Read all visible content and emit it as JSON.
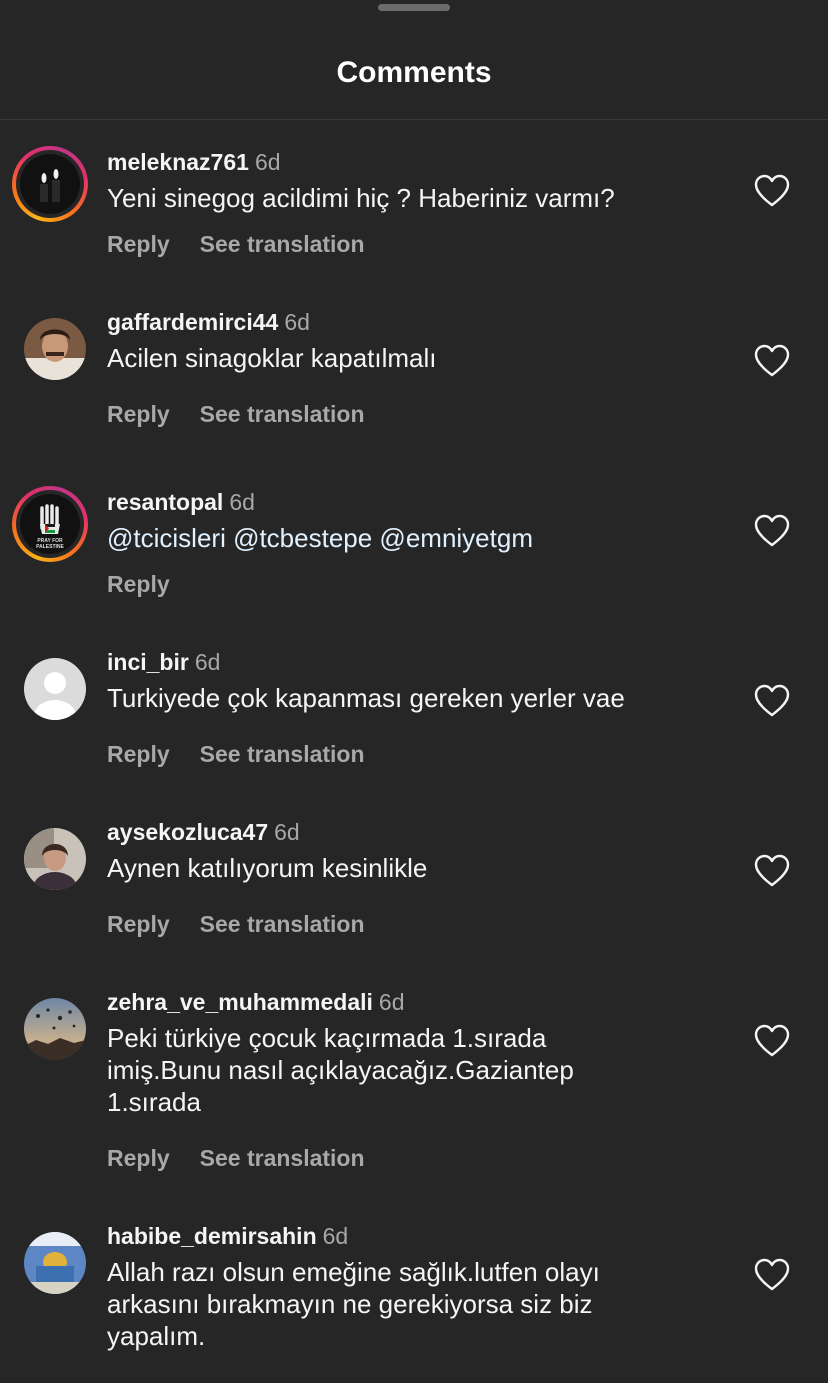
{
  "header": {
    "title": "Comments"
  },
  "common": {
    "reply_label": "Reply",
    "translate_label": "See translation"
  },
  "comments": [
    {
      "username": "meleknaz761",
      "time": "6d",
      "text": "Yeni sinegog acildimi hiç ? Haberiniz varmı?",
      "avatar": "candles-avatar",
      "has_story": true
    },
    {
      "username": "gaffardemirci44",
      "time": "6d",
      "text": "Acilen sinagoklar kapatılmalı",
      "avatar": "portrait-avatar",
      "has_story": false
    },
    {
      "username": "resantopal",
      "time": "6d",
      "text": "@tcicisleri @tcbestepe @emniyetgm",
      "avatar": "pray-for-palestine-avatar",
      "has_story": true,
      "avatar_text": "PRAY FOR PALESTINE"
    },
    {
      "username": "inci_bir",
      "time": "6d",
      "text": "Turkiyede çok kapanması gereken yerler vae",
      "avatar": "default-avatar",
      "has_story": false
    },
    {
      "username": "aysekozluca47",
      "time": "6d",
      "text": "Aynen katılıyorum kesinlikle",
      "avatar": "photo-avatar",
      "has_story": false
    },
    {
      "username": "zehra_ve_muhammedali",
      "time": "6d",
      "text": "Peki türkiye çocuk kaçırmada 1.sırada imiş.Bunu nasıl açıklayacağız.Gaziantep 1.sırada",
      "avatar": "balloons-avatar",
      "has_story": false
    },
    {
      "username": "habibe_demirsahin",
      "time": "6d",
      "text": "Allah razı olsun emeğine sağlık.lutfen olayı arkasını bırakmayın ne gerekiyorsa siz biz yapalım.",
      "avatar": "dome-avatar",
      "has_story": false
    }
  ],
  "colors": {
    "background": "#262626",
    "text": "#f5f5f5",
    "secondary": "#a8a8a8",
    "mention": "#e0f1ff"
  },
  "icons": {
    "like": "heart-outline-icon"
  }
}
